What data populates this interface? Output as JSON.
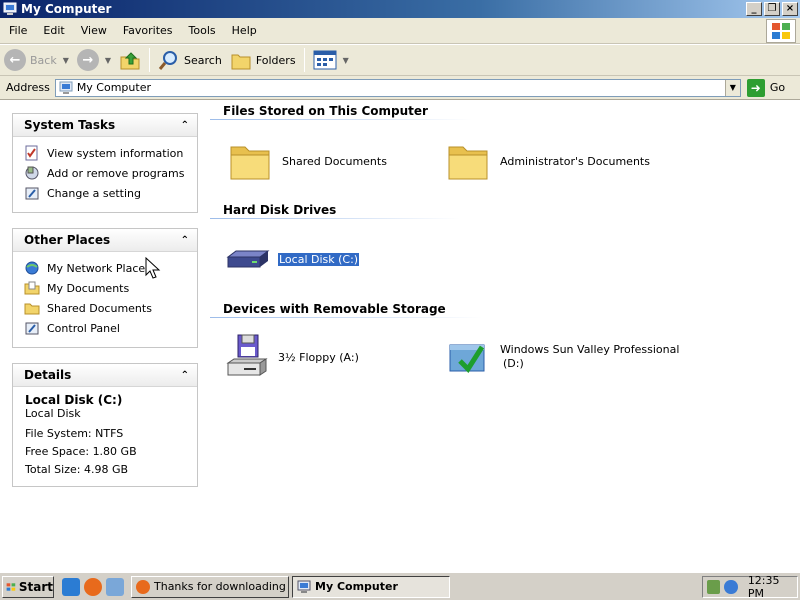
{
  "window": {
    "title": "My Computer"
  },
  "menu": [
    "File",
    "Edit",
    "View",
    "Favorites",
    "Tools",
    "Help"
  ],
  "toolbar": {
    "back_label": "Back",
    "search_label": "Search",
    "folders_label": "Folders"
  },
  "address": {
    "label": "Address",
    "value": "My Computer",
    "go_label": "Go"
  },
  "system_tasks": {
    "title": "System Tasks",
    "items": [
      "View system information",
      "Add or remove programs",
      "Change a setting"
    ]
  },
  "other_places": {
    "title": "Other Places",
    "items": [
      "My Network Places",
      "My Documents",
      "Shared Documents",
      "Control Panel"
    ]
  },
  "details": {
    "title": "Details",
    "name": "Local Disk (C:)",
    "type": "Local Disk",
    "file_system": "File System: NTFS",
    "free_space": "Free Space: 1.80 GB",
    "total_size": "Total Size: 4.98 GB"
  },
  "sections": {
    "files": {
      "title": "Files Stored on This Computer",
      "items": [
        "Shared Documents",
        "Administrator's Documents"
      ]
    },
    "disks": {
      "title": "Hard Disk Drives",
      "items": [
        "Local Disk (C:)"
      ]
    },
    "removable": {
      "title": "Devices with Removable Storage",
      "items": [
        "3½ Floppy (A:)",
        "Windows Sun Valley Professional",
        "(D:)"
      ]
    }
  },
  "taskbar": {
    "start_label": "Start",
    "tasks": [
      "Thanks for downloading ...",
      "My Computer"
    ],
    "clock": "12:35 PM"
  },
  "colors": {
    "selection": "#316ac5",
    "title_start": "#0a246a",
    "folder": "#f2d46a"
  }
}
